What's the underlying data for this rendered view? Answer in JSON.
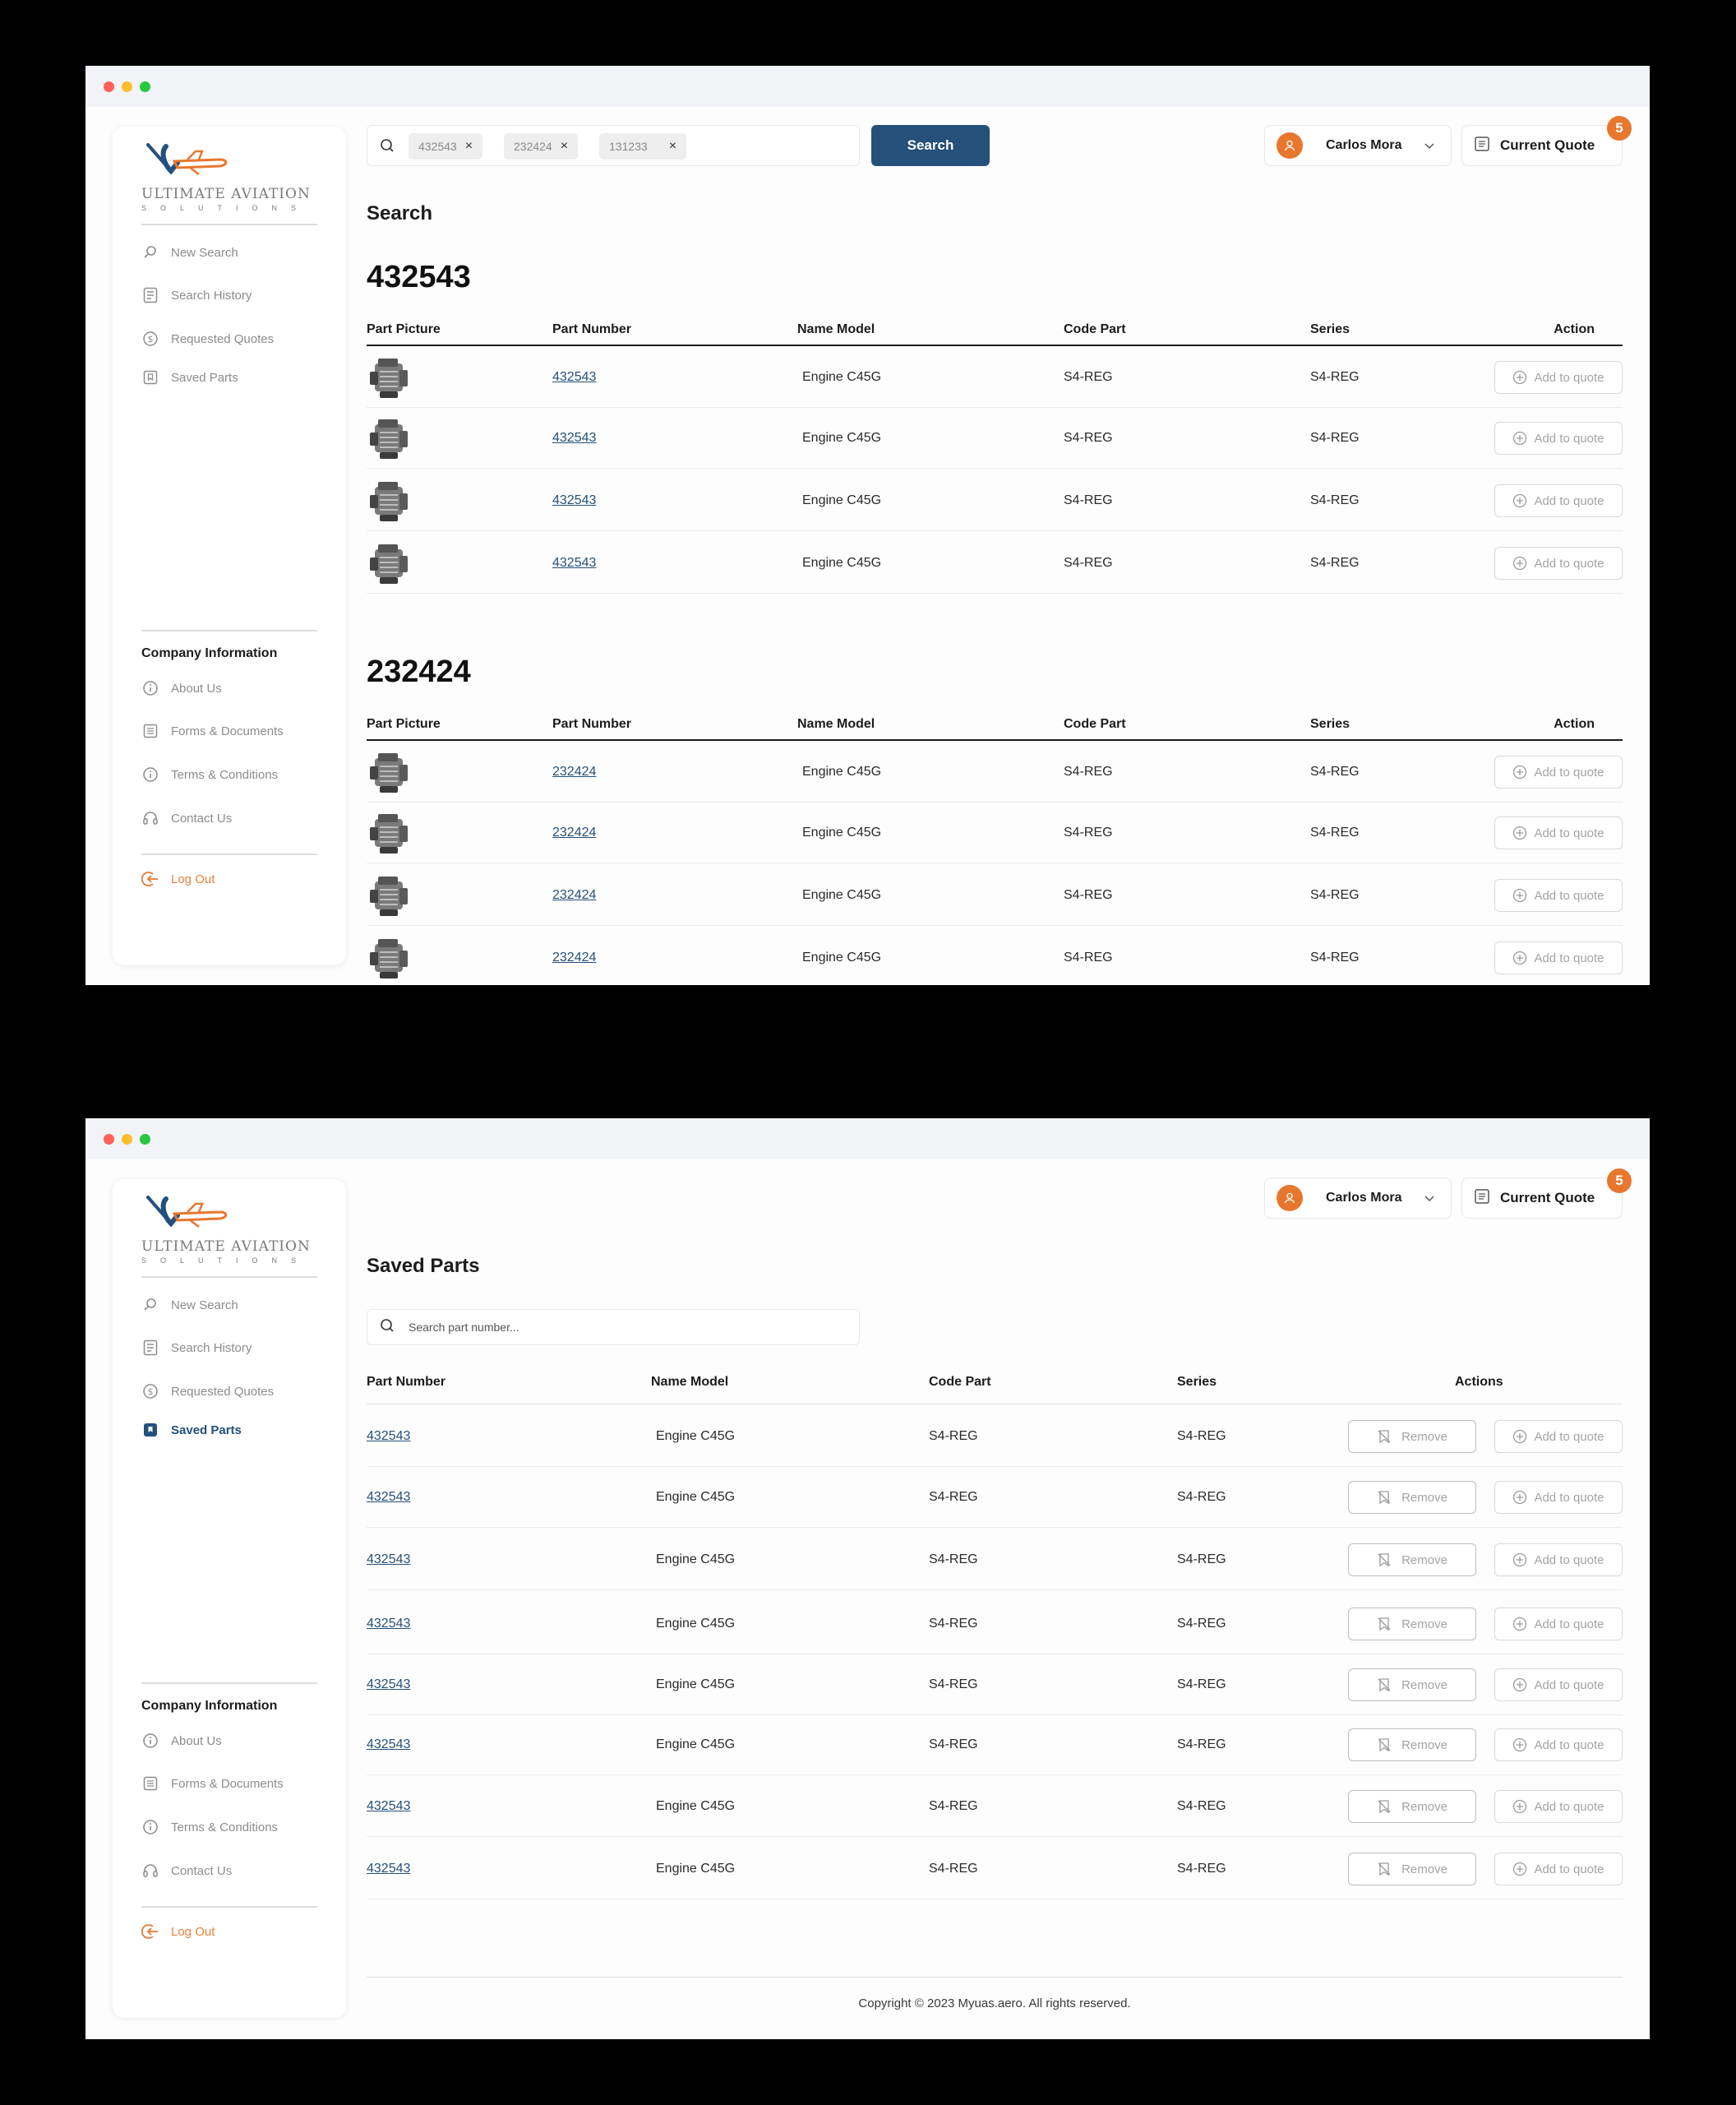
{
  "brand": {
    "name": "ULTIMATE AVIATION",
    "sub": "SOLUTIONS"
  },
  "colors": {
    "primary": "#24507a",
    "accent": "#e8772e",
    "background": "#000000"
  },
  "user": {
    "name": "Carlos Mora"
  },
  "quote": {
    "label": "Current Quote",
    "count": "5"
  },
  "nav": {
    "new_search": "New Search",
    "search_history": "Search History",
    "requested_quotes": "Requested Quotes",
    "saved_parts": "Saved Parts",
    "company_title": "Company Information",
    "about": "About Us",
    "forms": "Forms & Documents",
    "terms": "Terms & Conditions",
    "contact": "Contact Us",
    "logout": "Log Out"
  },
  "search_screen": {
    "chips": [
      "432543",
      "232424",
      "131233"
    ],
    "search_button": "Search",
    "title": "Search",
    "columns": [
      "Part Picture",
      "Part Number",
      "Name Model",
      "Code Part",
      "Series",
      "Action"
    ],
    "action_label": "Add to quote",
    "groups": [
      {
        "title": "432543",
        "rows": [
          {
            "part_number": "432543",
            "name_model": "Engine C45G",
            "code_part": "S4-REG",
            "series": "S4-REG"
          },
          {
            "part_number": "432543",
            "name_model": "Engine C45G",
            "code_part": "S4-REG",
            "series": "S4-REG"
          },
          {
            "part_number": "432543",
            "name_model": "Engine C45G",
            "code_part": "S4-REG",
            "series": "S4-REG"
          },
          {
            "part_number": "432543",
            "name_model": "Engine C45G",
            "code_part": "S4-REG",
            "series": "S4-REG"
          }
        ]
      },
      {
        "title": "232424",
        "rows": [
          {
            "part_number": "232424",
            "name_model": "Engine C45G",
            "code_part": "S4-REG",
            "series": "S4-REG"
          },
          {
            "part_number": "232424",
            "name_model": "Engine C45G",
            "code_part": "S4-REG",
            "series": "S4-REG"
          },
          {
            "part_number": "232424",
            "name_model": "Engine C45G",
            "code_part": "S4-REG",
            "series": "S4-REG"
          },
          {
            "part_number": "232424",
            "name_model": "Engine C45G",
            "code_part": "S4-REG",
            "series": "S4-REG"
          }
        ]
      }
    ]
  },
  "saved_screen": {
    "title": "Saved Parts",
    "search_placeholder": "Search part number...",
    "columns": [
      "Part Number",
      "Name Model",
      "Code Part",
      "Series",
      "Actions"
    ],
    "remove_label": "Remove",
    "add_label": "Add to quote",
    "rows": [
      {
        "part_number": "432543",
        "name_model": "Engine C45G",
        "code_part": "S4-REG",
        "series": "S4-REG"
      },
      {
        "part_number": "432543",
        "name_model": "Engine C45G",
        "code_part": "S4-REG",
        "series": "S4-REG"
      },
      {
        "part_number": "432543",
        "name_model": "Engine C45G",
        "code_part": "S4-REG",
        "series": "S4-REG"
      },
      {
        "part_number": "432543",
        "name_model": "Engine C45G",
        "code_part": "S4-REG",
        "series": "S4-REG"
      },
      {
        "part_number": "432543",
        "name_model": "Engine C45G",
        "code_part": "S4-REG",
        "series": "S4-REG"
      },
      {
        "part_number": "432543",
        "name_model": "Engine C45G",
        "code_part": "S4-REG",
        "series": "S4-REG"
      },
      {
        "part_number": "432543",
        "name_model": "Engine C45G",
        "code_part": "S4-REG",
        "series": "S4-REG"
      },
      {
        "part_number": "432543",
        "name_model": "Engine C45G",
        "code_part": "S4-REG",
        "series": "S4-REG"
      }
    ],
    "footer": "Copyright © 2023 Myuas.aero. All rights reserved."
  }
}
